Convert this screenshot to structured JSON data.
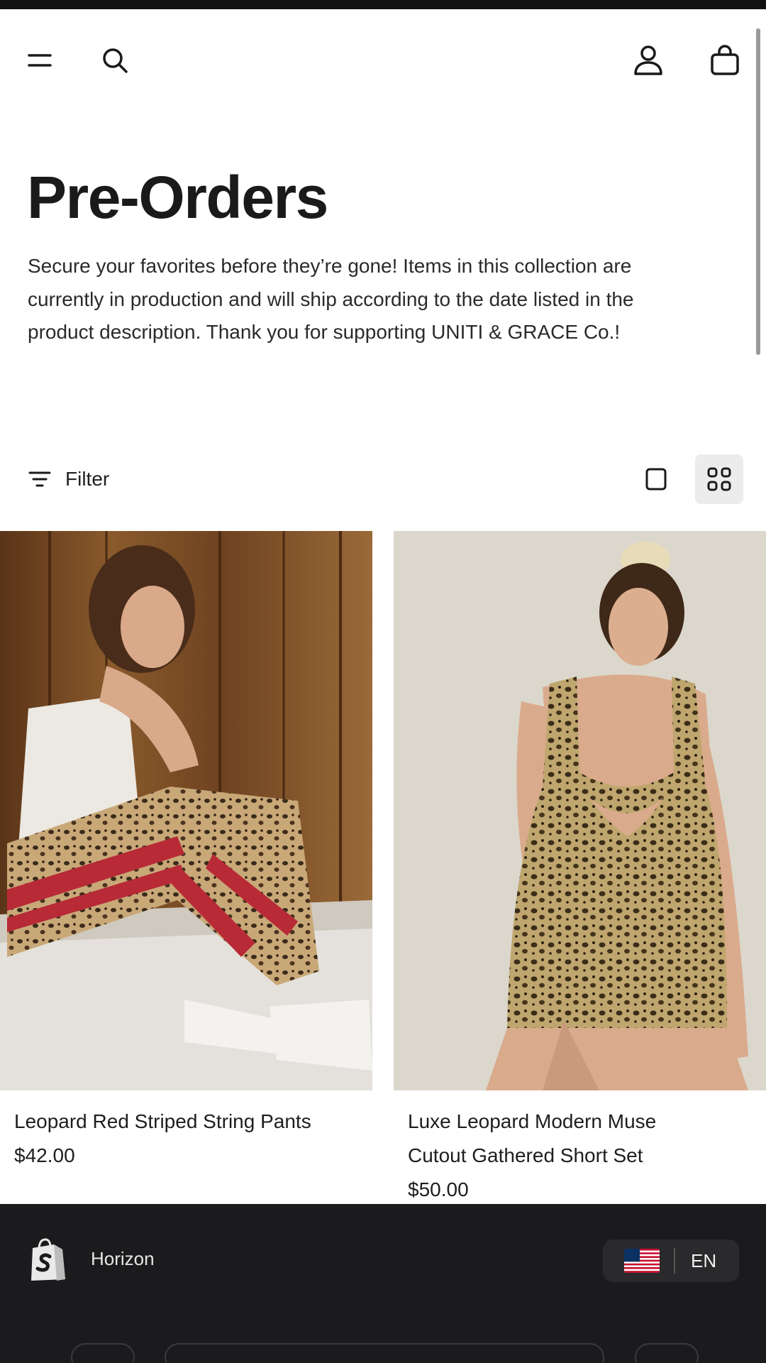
{
  "header": {
    "menu_icon": "menu-icon",
    "search_icon": "search-icon",
    "account_icon": "account-icon",
    "cart_icon": "cart-icon"
  },
  "collection": {
    "title": "Pre-Orders",
    "description": "Secure your favorites before they’re gone! Items in this collection are currently in production and will ship according to the date listed in the product description. Thank you for supporting UNITI & GRACE Co.!"
  },
  "toolbar": {
    "filter_label": "Filter",
    "view_options": [
      "single-column-view",
      "grid-view"
    ],
    "active_view": "grid-view"
  },
  "products": [
    {
      "name": "Leopard Red Striped String Pants",
      "price": "$42.00"
    },
    {
      "name_line1": "Luxe Leopard Modern Muse",
      "name_line2": "Cutout Gathered Short Set",
      "price": "$50.00"
    }
  ],
  "footer": {
    "brand": "Horizon",
    "locale_code": "EN",
    "locale_flag": "us-flag-icon"
  },
  "colors": {
    "footer_bg": "#1b1b1d",
    "text": "#1c1c1c",
    "active_view_bg": "#ececec"
  }
}
